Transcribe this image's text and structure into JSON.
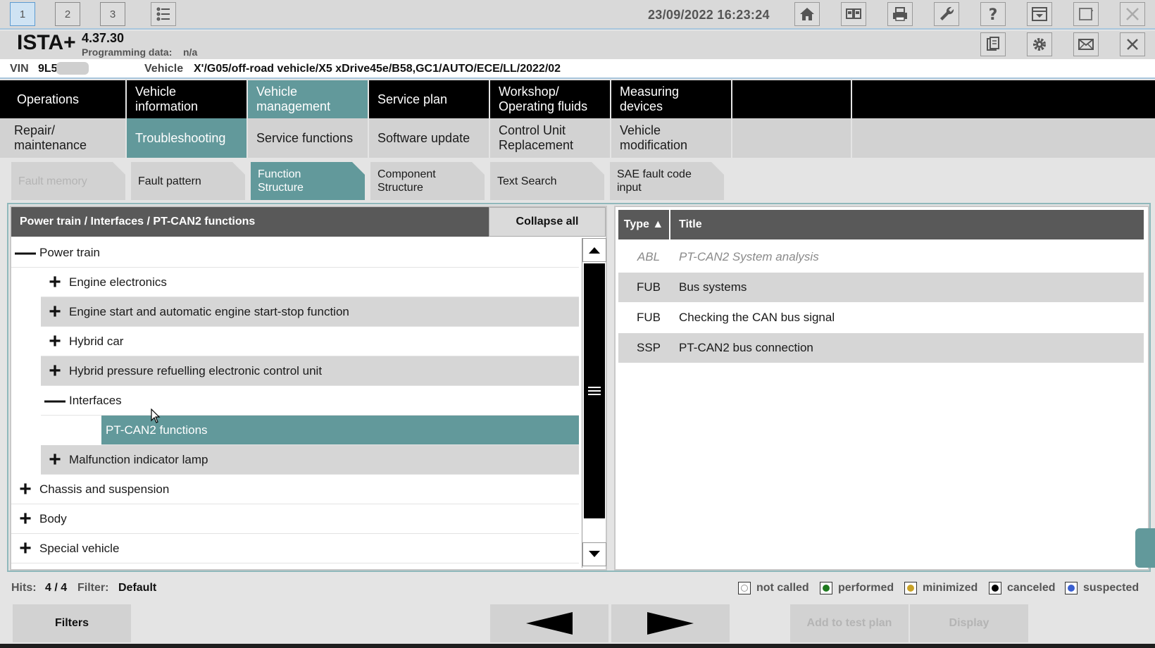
{
  "titlebar": {
    "session_tabs": [
      "1",
      "2",
      "3"
    ],
    "datetime": "23/09/2022 16:23:24"
  },
  "header": {
    "app_name": "ISTA+",
    "version": "4.37.30",
    "programming_label": "Programming data:",
    "programming_value": "n/a"
  },
  "vehicle": {
    "vin_label": "VIN",
    "vin_value": "9L5",
    "vehicle_label": "Vehicle",
    "vehicle_value": "X'/G05/off-road vehicle/X5 xDrive45e/B58,GC1/AUTO/ECE/LL/2022/02"
  },
  "main_tabs": [
    "Operations",
    "Vehicle information",
    "Vehicle management",
    "Service plan",
    "Workshop/ Operating fluids",
    "Measuring devices"
  ],
  "sub_tabs": [
    "Repair/ maintenance",
    "Troubleshooting",
    "Service functions",
    "Software update",
    "Control Unit Replacement",
    "Vehicle modification"
  ],
  "third_tabs": [
    "Fault memory",
    "Fault pattern",
    "Function Structure",
    "Component Structure",
    "Text Search",
    "SAE fault code input"
  ],
  "tree": {
    "breadcrumb": "Power train / Interfaces / PT-CAN2 functions",
    "collapse_label": "Collapse all",
    "rows": [
      {
        "sign": "—",
        "label": "Power train"
      },
      {
        "sign": "+",
        "label": "Engine electronics"
      },
      {
        "sign": "+",
        "label": "Engine start and automatic engine start-stop function"
      },
      {
        "sign": "+",
        "label": "Hybrid car"
      },
      {
        "sign": "+",
        "label": "Hybrid pressure refuelling electronic control unit"
      },
      {
        "sign": "—",
        "label": "Interfaces"
      },
      {
        "sign": "",
        "label": "PT-CAN2 functions"
      },
      {
        "sign": "+",
        "label": "Malfunction indicator lamp"
      },
      {
        "sign": "+",
        "label": "Chassis and suspension"
      },
      {
        "sign": "+",
        "label": "Body"
      },
      {
        "sign": "+",
        "label": "Special vehicle"
      }
    ]
  },
  "results": {
    "col_type": "Type ▲",
    "col_title": "Title",
    "rows": [
      {
        "type": "ABL",
        "title": "PT-CAN2 System analysis"
      },
      {
        "type": "FUB",
        "title": "Bus systems"
      },
      {
        "type": "FUB",
        "title": "Checking the CAN bus signal"
      },
      {
        "type": "SSP",
        "title": "PT-CAN2 bus connection"
      }
    ]
  },
  "status": {
    "hits_label": "Hits:",
    "hits_value": "4 / 4",
    "filter_label": "Filter:",
    "filter_value": "Default",
    "legend": [
      {
        "label": "not called",
        "color": "#ffffff"
      },
      {
        "label": "performed",
        "color": "#1f7a1f"
      },
      {
        "label": "minimized",
        "color": "#c9a227"
      },
      {
        "label": "canceled",
        "color": "#000000"
      },
      {
        "label": "suspected",
        "color": "#3a5fd0"
      }
    ]
  },
  "buttons": {
    "filters": "Filters",
    "add_to_test_plan": "Add to test plan",
    "display": "Display"
  },
  "colors": {
    "accent": "#62999b",
    "header_dark": "#595959",
    "nav_black": "#000000"
  }
}
